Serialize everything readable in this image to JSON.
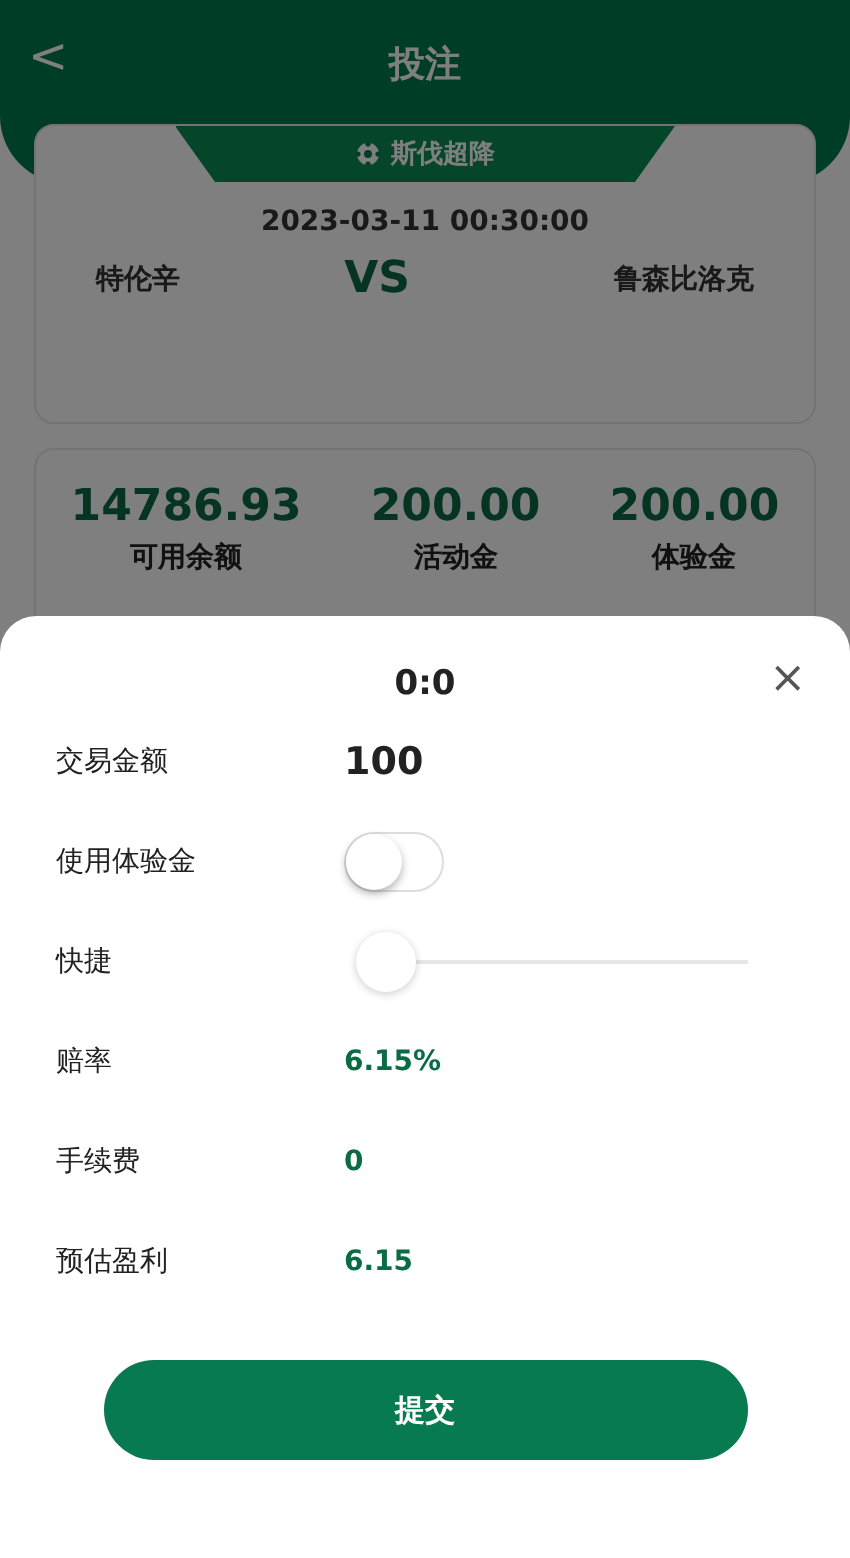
{
  "header": {
    "back": "<",
    "title": "投注"
  },
  "match": {
    "league": "斯伐超降",
    "time": "2023-03-11 00:30:00",
    "home": "特伦辛",
    "vs": "VS",
    "away": "鲁森比洛克"
  },
  "balances": [
    {
      "amount": "14786.93",
      "label": "可用余额"
    },
    {
      "amount": "200.00",
      "label": "活动金"
    },
    {
      "amount": "200.00",
      "label": "体验金"
    }
  ],
  "sheet": {
    "title": "0:0",
    "close": "×",
    "rows": [
      {
        "kind": "input",
        "label": "交易金额",
        "value": "100"
      },
      {
        "kind": "toggle",
        "label": "使用体验金",
        "on": false
      },
      {
        "kind": "slider",
        "label": "快捷",
        "level": 0
      },
      {
        "kind": "text",
        "label": "赔率",
        "value": "6.15%"
      },
      {
        "kind": "text",
        "label": "手续费",
        "value": "0"
      },
      {
        "kind": "text",
        "label": "预估盈利",
        "value": "6.15"
      }
    ],
    "submit": "提交"
  }
}
